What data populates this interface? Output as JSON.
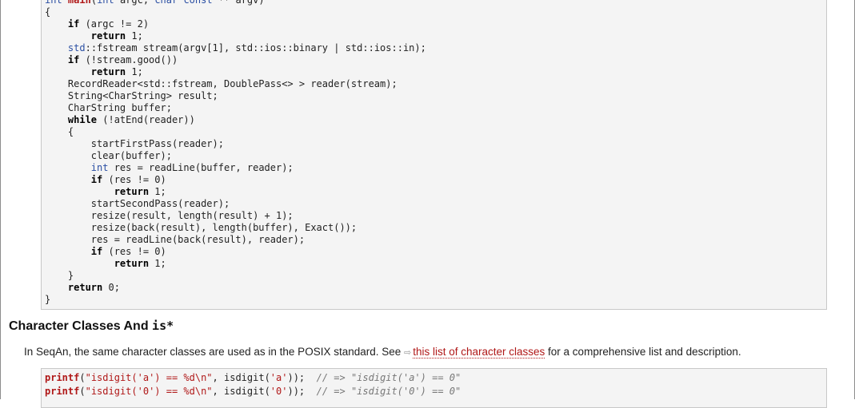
{
  "code_block_1": {
    "lines": [
      [
        [
          "type",
          "int"
        ],
        [
          "plain",
          " "
        ],
        [
          "kwred",
          "main"
        ],
        [
          "plain",
          "("
        ],
        [
          "type",
          "int"
        ],
        [
          "plain",
          " argc, "
        ],
        [
          "type",
          "char const"
        ],
        [
          "plain",
          " ** argv)"
        ]
      ],
      [
        [
          "plain",
          "{"
        ]
      ],
      [
        [
          "plain",
          "    "
        ],
        [
          "kw",
          "if"
        ],
        [
          "plain",
          " (argc != 2)"
        ]
      ],
      [
        [
          "plain",
          "        "
        ],
        [
          "kw",
          "return"
        ],
        [
          "plain",
          " 1;"
        ]
      ],
      [
        [
          "plain",
          "    "
        ],
        [
          "type",
          "std"
        ],
        [
          "plain",
          "::fstream stream(argv[1], std::ios::binary | std::ios::in);"
        ]
      ],
      [
        [
          "plain",
          "    "
        ],
        [
          "kw",
          "if"
        ],
        [
          "plain",
          " (!stream.good())"
        ]
      ],
      [
        [
          "plain",
          "        "
        ],
        [
          "kw",
          "return"
        ],
        [
          "plain",
          " 1;"
        ]
      ],
      [
        [
          "plain",
          "    RecordReader<std::fstream, DoublePass<> > reader(stream);"
        ]
      ],
      [
        [
          "plain",
          "    String<CharString> result;"
        ]
      ],
      [
        [
          "plain",
          "    CharString buffer;"
        ]
      ],
      [
        [
          "plain",
          "    "
        ],
        [
          "kw",
          "while"
        ],
        [
          "plain",
          " (!atEnd(reader))"
        ]
      ],
      [
        [
          "plain",
          "    {"
        ]
      ],
      [
        [
          "plain",
          "        startFirstPass(reader);"
        ]
      ],
      [
        [
          "plain",
          "        clear(buffer);"
        ]
      ],
      [
        [
          "plain",
          "        "
        ],
        [
          "type",
          "int"
        ],
        [
          "plain",
          " res = readLine(buffer, reader);"
        ]
      ],
      [
        [
          "plain",
          "        "
        ],
        [
          "kw",
          "if"
        ],
        [
          "plain",
          " (res != 0)"
        ]
      ],
      [
        [
          "plain",
          "            "
        ],
        [
          "kw",
          "return"
        ],
        [
          "plain",
          " 1;"
        ]
      ],
      [
        [
          "plain",
          "        startSecondPass(reader);"
        ]
      ],
      [
        [
          "plain",
          "        resize(result, length(result) + 1);"
        ]
      ],
      [
        [
          "plain",
          "        resize(back(result), length(buffer), Exact());"
        ]
      ],
      [
        [
          "plain",
          "        res = readLine(back(result), reader);"
        ]
      ],
      [
        [
          "plain",
          "        "
        ],
        [
          "kw",
          "if"
        ],
        [
          "plain",
          " (res != 0)"
        ]
      ],
      [
        [
          "plain",
          "            "
        ],
        [
          "kw",
          "return"
        ],
        [
          "plain",
          " 1;"
        ]
      ],
      [
        [
          "plain",
          "    }"
        ]
      ],
      [
        [
          "plain",
          "    "
        ],
        [
          "kw",
          "return"
        ],
        [
          "plain",
          " 0;"
        ]
      ],
      [
        [
          "plain",
          "}"
        ]
      ]
    ]
  },
  "heading": {
    "text": "Character Classes And ",
    "mono": "is*"
  },
  "paragraph": {
    "before": "In SeqAn, the same character classes are used as in the POSIX standard. See ",
    "link_icon": "external-link-icon",
    "link_text": "this list of character classes",
    "after": " for a comprehensive list and description."
  },
  "code_block_2": {
    "lines": [
      [
        [
          "kwred",
          "printf"
        ],
        [
          "plain",
          "("
        ],
        [
          "str",
          "\"isdigit('a') == %d\\n\""
        ],
        [
          "plain",
          ", isdigit("
        ],
        [
          "str",
          "'a'"
        ],
        [
          "plain",
          "));  "
        ],
        [
          "com",
          "// => \"isdigit('a') == 0\""
        ]
      ],
      [
        [
          "kwred",
          "printf"
        ],
        [
          "plain",
          "("
        ],
        [
          "str",
          "\"isdigit('0') == %d\\n\""
        ],
        [
          "plain",
          ", isdigit("
        ],
        [
          "str",
          "'0'"
        ],
        [
          "plain",
          "));  "
        ],
        [
          "com",
          "// => \"isdigit('0') == 0\""
        ]
      ]
    ]
  },
  "colors": {
    "link": "#b01818",
    "code_background": "#f4f4f4",
    "code_border": "#c8c8c8",
    "type_blue": "#2b4fa3",
    "string_red": "#b01818",
    "comment_gray": "#777777"
  }
}
